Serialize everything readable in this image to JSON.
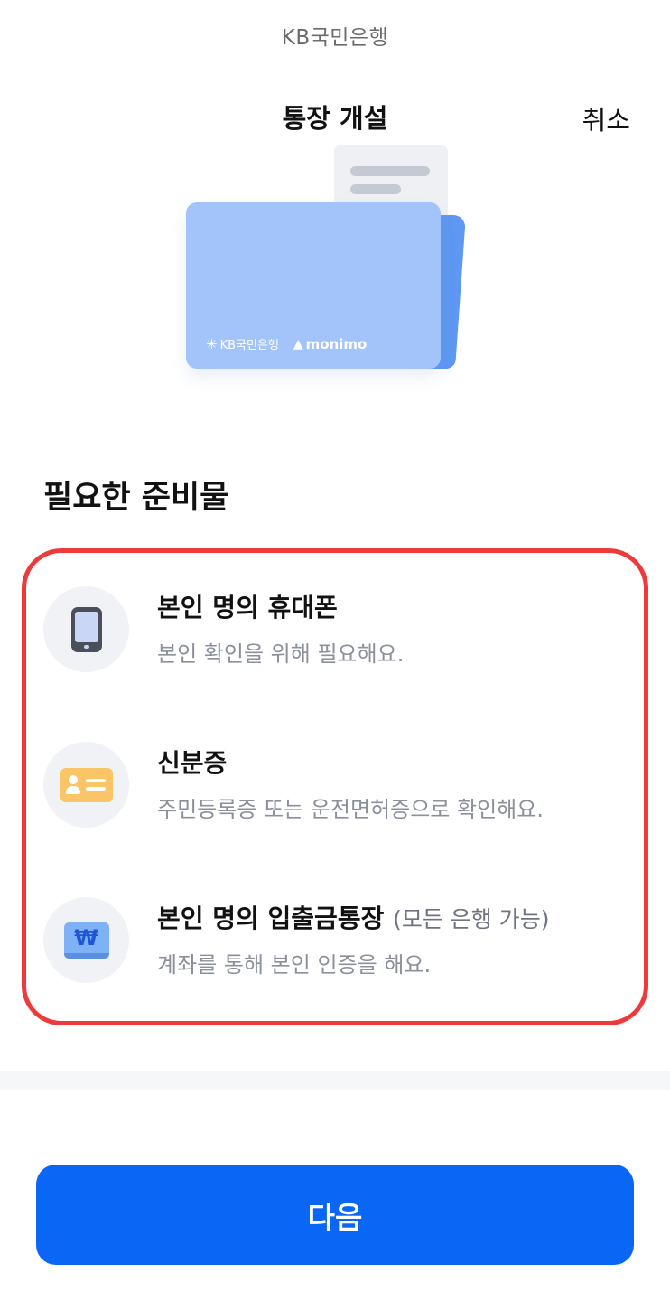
{
  "brand": {
    "text": "KB국민은행"
  },
  "header": {
    "title": "통장 개설",
    "cancel_label": "취소"
  },
  "illustration": {
    "kb_logo_text": "KB국민은행",
    "monimo_logo_text": "monimo"
  },
  "section": {
    "title": "필요한 준비물"
  },
  "requirements": [
    {
      "title": "본인 명의 휴대폰",
      "note": "",
      "description": "본인 확인을 위해 필요해요.",
      "icon": "phone-icon"
    },
    {
      "title": "신분증",
      "note": "",
      "description": "주민등록증 또는 운전면허증으로 확인해요.",
      "icon": "id-card-icon"
    },
    {
      "title": "본인 명의 입출금통장",
      "note": "(모든 은행 가능)",
      "description": "계좌를 통해 본인 인증을 해요.",
      "icon": "bankbook-icon"
    }
  ],
  "footer": {
    "next_label": "다음"
  },
  "colors": {
    "primary_button": "#0a66f5",
    "highlight_border": "#ee3a3a",
    "folder": "#a3c4fb",
    "id_card": "#f9c567"
  }
}
